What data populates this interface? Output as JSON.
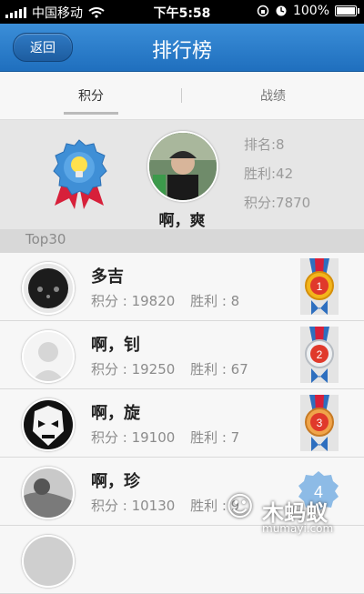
{
  "status": {
    "carrier": "中国移动",
    "time": "下午5:58",
    "battery": "100%",
    "battery_level": 1.0
  },
  "nav": {
    "back_label": "返回",
    "title": "排行榜"
  },
  "tabs": [
    {
      "label": "积分",
      "active": true
    },
    {
      "label": "战绩",
      "active": false
    }
  ],
  "me": {
    "name": "啊，爽",
    "rank": "排名:8",
    "wins": "胜利:42",
    "score": "积分:7870"
  },
  "section_label": "Top30",
  "list": [
    {
      "name": "多吉",
      "score": "积分 : 19820",
      "wins": "胜利 : 8",
      "rank": "1"
    },
    {
      "name": "啊，钊",
      "score": "积分 : 19250",
      "wins": "胜利 : 67",
      "rank": "2"
    },
    {
      "name": "啊，旋",
      "score": "积分 : 19100",
      "wins": "胜利 : 7",
      "rank": "3"
    },
    {
      "name": "啊，珍",
      "score": "积分 : 10130",
      "wins": "胜利 : 9",
      "rank": "4"
    }
  ],
  "watermark": {
    "text": "木蚂蚁",
    "url": "mumayi.com"
  },
  "colors": {
    "nav": "#2a7fcc",
    "gold": "#f3b51b",
    "silver": "#cfd3d8",
    "bronze": "#f0a44a",
    "rank4": "#8dbbe6"
  }
}
